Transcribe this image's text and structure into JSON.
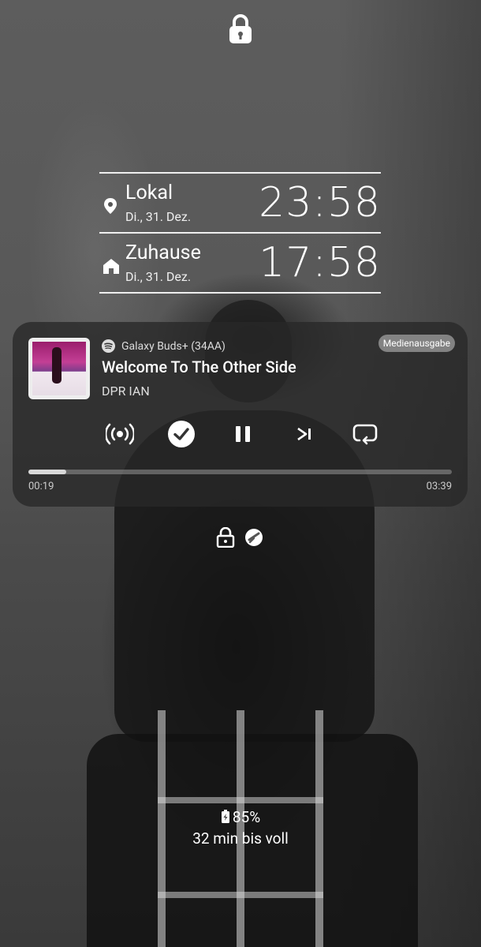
{
  "status": {
    "lock_icon": "padlock-locked-icon"
  },
  "clocks": [
    {
      "city": "Lokal",
      "date": "Di., 31. Dez.",
      "time": "23:58",
      "icon": "location-pin-icon"
    },
    {
      "city": "Zuhause",
      "date": "Di., 31. Dez.",
      "time": "17:58",
      "icon": "home-icon"
    }
  ],
  "media": {
    "source_app_icon": "spotify-icon",
    "device": "Galaxy Buds+ (34AA)",
    "output_chip": "Medienausgabe",
    "title": "Welcome To The Other Side",
    "artist": "DPR IAN",
    "elapsed": "00:19",
    "duration": "03:39",
    "progress_fraction": 0.09,
    "controls": [
      "broadcast-icon",
      "checkmark-icon",
      "pause-icon",
      "skip-next-icon",
      "repeat-icon"
    ]
  },
  "lower_icons": [
    "lock-icon",
    "no-disturb-icon"
  ],
  "battery": {
    "percent": "85%",
    "charging_text": "32 min bis voll"
  }
}
